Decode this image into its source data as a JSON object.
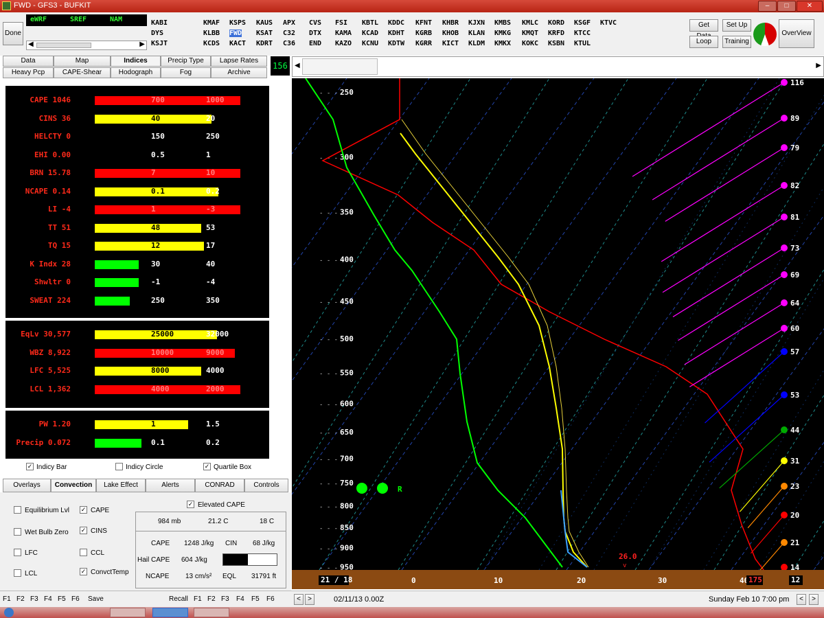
{
  "window": {
    "title": "FWD - GFS3 - BUFKIT"
  },
  "toolbar": {
    "done_label": "Done",
    "models": [
      "eWRF",
      "SREF",
      "NAM"
    ],
    "station_columns": [
      [
        "KABI",
        "DYS",
        "KSJT"
      ],
      [
        "KMAF",
        "KLBB",
        "KCDS"
      ],
      [
        "KSPS",
        "FWD",
        "KACT"
      ],
      [
        "KAUS",
        "KSAT",
        "KDRT"
      ],
      [
        "APX",
        "C32",
        "C36"
      ],
      [
        "CVS",
        "DTX",
        "END"
      ],
      [
        "FSI",
        "KAMA",
        "KAZO"
      ],
      [
        "KBTL",
        "KCAD",
        "KCNU"
      ],
      [
        "KDDC",
        "KDHT",
        "KDTW"
      ],
      [
        "KFNT",
        "KGRB",
        "KGRR"
      ],
      [
        "KHBR",
        "KHOB",
        "KICT"
      ],
      [
        "KJXN",
        "KLAN",
        "KLDM"
      ],
      [
        "KMBS",
        "KMKG",
        "KMKX"
      ],
      [
        "KMLC",
        "KMQT",
        "KOKC"
      ],
      [
        "KORD",
        "KRFD",
        "KSBN"
      ],
      [
        "KSGF",
        "KTCC",
        "KTUL"
      ],
      [
        "KTVC",
        "",
        ""
      ]
    ],
    "selected_station": "FWD",
    "get_data_label": "Get Data",
    "loop_label": "Loop",
    "setup_label": "Set Up",
    "training_label": "Training",
    "overview_label": "OverView",
    "frame_number": "156"
  },
  "tabs_row1": [
    "Data",
    "Map",
    "Indices",
    "Precip Type",
    "Lapse Rates"
  ],
  "tabs_row2": [
    "Heavy Pcp",
    "CAPE-Shear",
    "Hodograph",
    "Fog",
    "Archive"
  ],
  "active_tab": "Indices",
  "indices": [
    {
      "label": "CAPE 1046",
      "bar_color": "#ff0000",
      "fill": 1.0,
      "threshold1": "700",
      "threshold2": "1000"
    },
    {
      "label": "CINS 36",
      "bar_color": "#ffff00",
      "fill": 0.8,
      "threshold1": "40",
      "threshold2": "20"
    },
    {
      "label": "HELCTY 0",
      "bar_color": "",
      "fill": 0,
      "threshold1": "150",
      "threshold2": "250"
    },
    {
      "label": "EHI 0.00",
      "bar_color": "",
      "fill": 0,
      "threshold1": "0.5",
      "threshold2": "1"
    },
    {
      "label": "BRN 15.78",
      "bar_color": "#ff0000",
      "fill": 1.0,
      "threshold1": "7",
      "threshold2": "10"
    },
    {
      "label": "NCAPE 0.14",
      "bar_color": "#ffff00",
      "fill": 0.85,
      "threshold1": "0.1",
      "threshold2": "0.2"
    },
    {
      "label": "LI -4",
      "bar_color": "#ff0000",
      "fill": 1.0,
      "threshold1": "1",
      "threshold2": "-3"
    },
    {
      "label": "TT 51",
      "bar_color": "#ffff00",
      "fill": 0.73,
      "threshold1": "48",
      "threshold2": "53"
    },
    {
      "label": "TQ 15",
      "bar_color": "#ffff00",
      "fill": 0.75,
      "threshold1": "12",
      "threshold2": "17"
    },
    {
      "label": "K Indx 28",
      "bar_color": "#00ff00",
      "fill": 0.3,
      "threshold1": "30",
      "threshold2": "40"
    },
    {
      "label": "Shwltr 0",
      "bar_color": "#00ff00",
      "fill": 0.3,
      "threshold1": "-1",
      "threshold2": "-4"
    },
    {
      "label": "SWEAT 224",
      "bar_color": "#00ff00",
      "fill": 0.24,
      "threshold1": "250",
      "threshold2": "350"
    }
  ],
  "heights": [
    {
      "label": "EqLv 30,577",
      "bar_color": "#ffff00",
      "fill": 0.84,
      "threshold1": "25000",
      "threshold2": "32000"
    },
    {
      "label": "WBZ 8,922",
      "bar_color": "#ff0000",
      "fill": 0.96,
      "threshold1": "10000",
      "threshold2": "9000"
    },
    {
      "label": "LFC 5,525",
      "bar_color": "#ffff00",
      "fill": 0.73,
      "threshold1": "8000",
      "threshold2": "4000"
    },
    {
      "label": "LCL 1,362",
      "bar_color": "#ff0000",
      "fill": 1.0,
      "threshold1": "4000",
      "threshold2": "2000"
    }
  ],
  "moisture": [
    {
      "label": "PW 1.20",
      "bar_color": "#ffff00",
      "fill": 0.64,
      "threshold1": "1",
      "threshold2": "1.5"
    },
    {
      "label": "Precip 0.072",
      "bar_color": "#00ff00",
      "fill": 0.32,
      "threshold1": "0.1",
      "threshold2": "0.2"
    }
  ],
  "indices_options": [
    {
      "label": "Indicy Bar",
      "checked": true
    },
    {
      "label": "Indicy Circle",
      "checked": false
    },
    {
      "label": "Quartile Box",
      "checked": true
    }
  ],
  "bottom_tabs": [
    "Overlays",
    "Convection",
    "Lake Effect",
    "Alerts",
    "CONRAD",
    "Controls"
  ],
  "bottom_active_tab": "Convection",
  "convection": {
    "checkboxes": [
      {
        "label": "Equilibrium Lvl",
        "checked": false
      },
      {
        "label": "CAPE",
        "checked": true
      },
      {
        "label": "Wet Bulb Zero",
        "checked": false
      },
      {
        "label": "CINS",
        "checked": true
      },
      {
        "label": "LFC",
        "checked": false
      },
      {
        "label": "CCL",
        "checked": false
      },
      {
        "label": "LCL",
        "checked": false
      },
      {
        "label": "ConvctTemp",
        "checked": true
      }
    ],
    "elevated_cape_label": "Elevated CAPE",
    "elevated_cape_checked": true,
    "parcel_mb": "984 mb",
    "parcel_temp": "21.2 C",
    "parcel_dew": "18 C",
    "cape_label": "CAPE",
    "cape_value": "1248 J/kg",
    "cin_label": "CIN",
    "cin_value": "68 J/kg",
    "hail_cape_label": "Hail CAPE",
    "hail_cape_value": "604 J/kg",
    "ncape_label": "NCAPE",
    "ncape_value": "13 cm/s²",
    "eql_label": "EQL",
    "eql_value": "31791 ft"
  },
  "fkeys_left": [
    "F1",
    "F2",
    "F3",
    "F4",
    "F5",
    "F6",
    "Save"
  ],
  "fkeys_right": [
    "Recall",
    "F1",
    "F2",
    "F3",
    "F4",
    "F5",
    "F6"
  ],
  "sounding": {
    "pressure_levels": [
      "250",
      "300",
      "350",
      "400",
      "450",
      "500",
      "550",
      "600",
      "650",
      "700",
      "750",
      "800",
      "850",
      "900",
      "950"
    ],
    "temp_axis": [
      "0",
      "10",
      "20",
      "30",
      "40"
    ],
    "surface_temp_dew": "21 / 18",
    "surface_label": "26.0",
    "ground_left_label": "175",
    "ground_right_label": "12",
    "storm_label": "R",
    "wind_speeds": [
      "116",
      "89",
      "79",
      "82",
      "81",
      "73",
      "69",
      "64",
      "60",
      "57",
      "53",
      "44",
      "31",
      "23",
      "20",
      "21",
      "14"
    ],
    "wind_colors": [
      "#ff00ff",
      "#ff00ff",
      "#ff00ff",
      "#ff00ff",
      "#ff00ff",
      "#ff00ff",
      "#ff00ff",
      "#ff00ff",
      "#ff00ff",
      "#0000ff",
      "#0000ff",
      "#00aa00",
      "#ffff00",
      "#ff8800",
      "#ff0000",
      "#ff8800",
      "#ff0000"
    ]
  },
  "status": {
    "run_time": "02/11/13  0.00Z",
    "valid_time": "Sunday  Feb 10  7:00 pm"
  },
  "colors": {
    "temperature": "#ff0000",
    "dewpoint": "#00ff00",
    "parcel": "#ffff00",
    "wetbulb": "#3aa0ff",
    "ground": "#8b4a12"
  }
}
